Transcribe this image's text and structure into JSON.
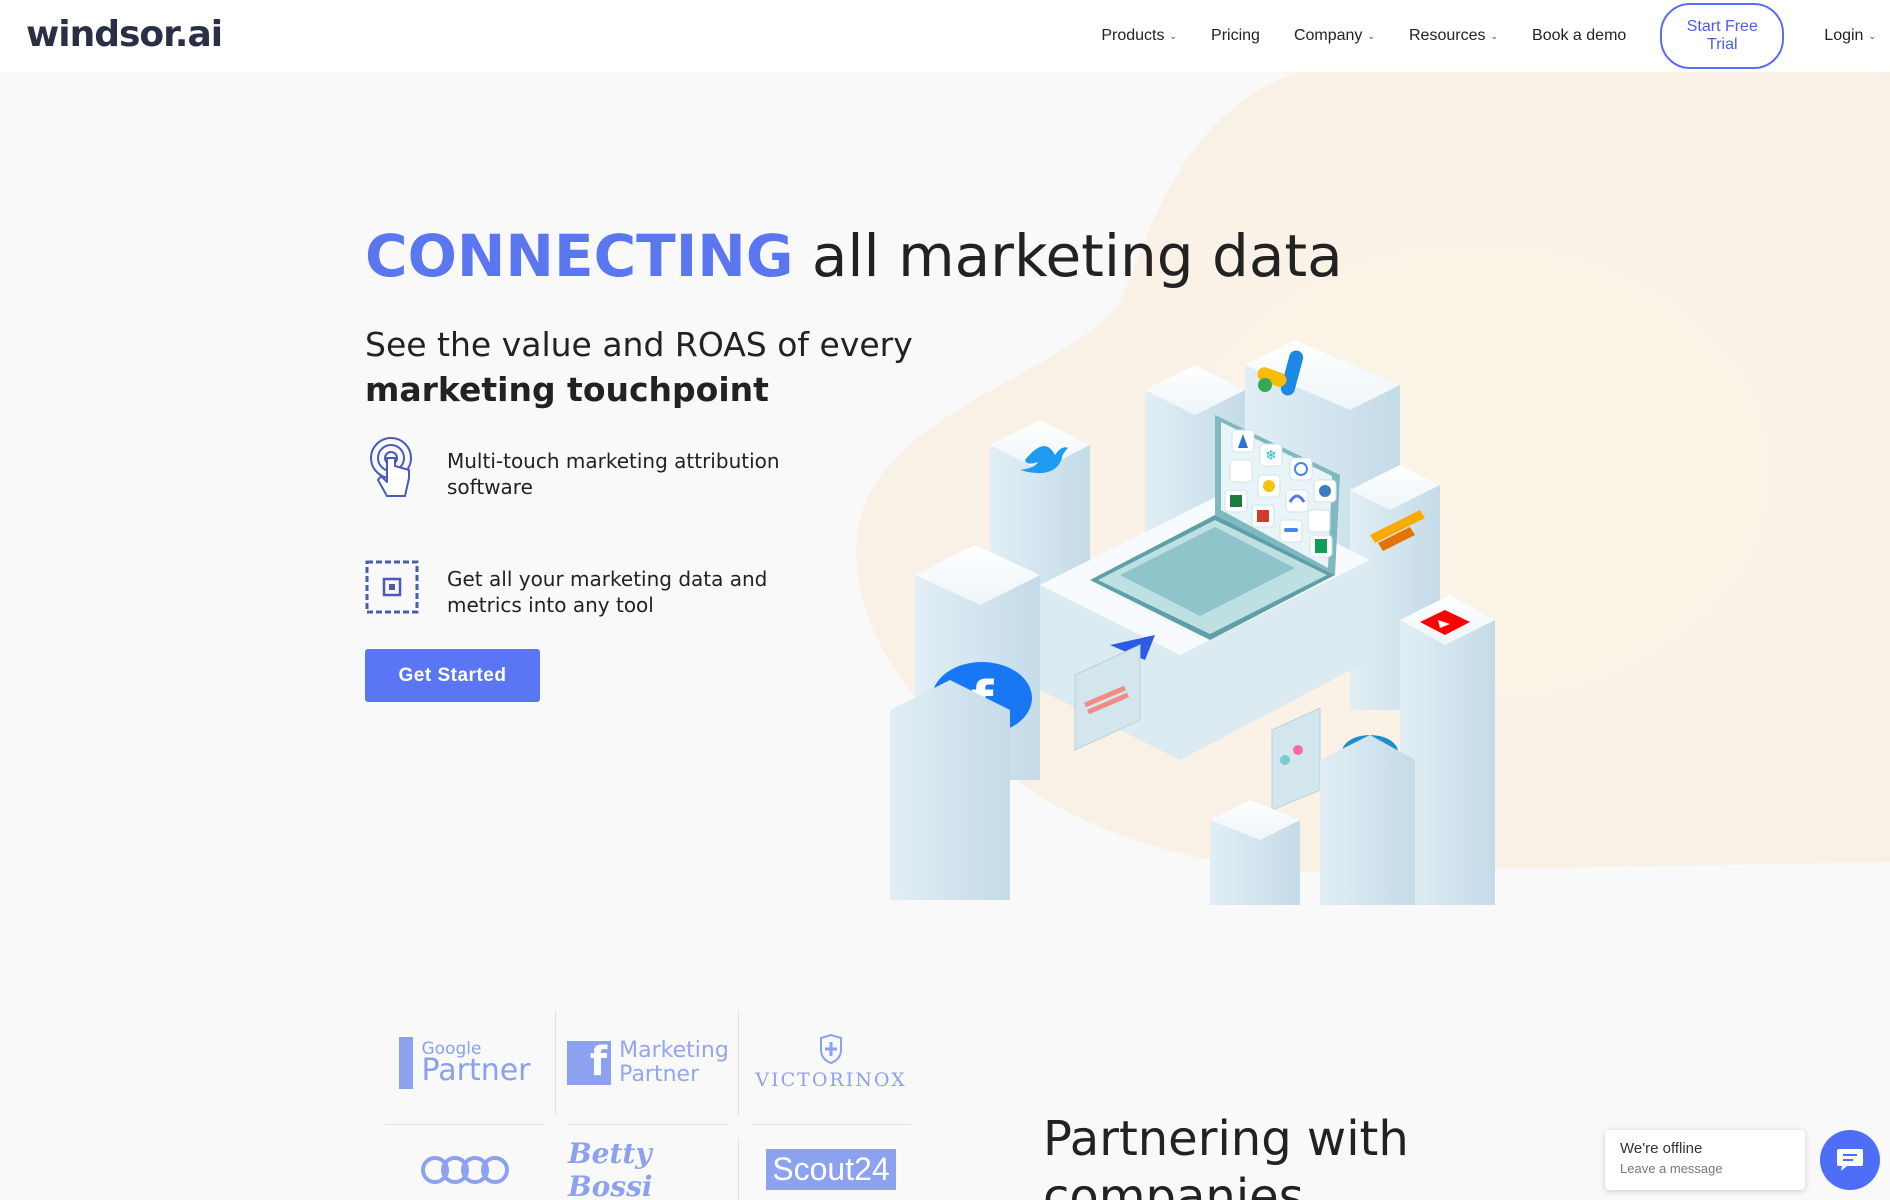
{
  "nav": {
    "logo": "windsor.ai",
    "items": [
      {
        "label": "Products",
        "has_dropdown": true
      },
      {
        "label": "Pricing",
        "has_dropdown": false
      },
      {
        "label": "Company",
        "has_dropdown": true
      },
      {
        "label": "Resources",
        "has_dropdown": true
      },
      {
        "label": "Book a demo",
        "has_dropdown": false
      }
    ],
    "trial_label": "Start Free Trial",
    "login_label": "Login"
  },
  "hero": {
    "headline_accent": "CONNECTING",
    "headline_rest": "all marketing data",
    "subhead_line1": "See the value and ROAS of every",
    "subhead_line2": "marketing touchpoint",
    "features": [
      {
        "icon": "touch-icon",
        "text": "Multi-touch marketing attribution software"
      },
      {
        "icon": "frame-icon",
        "text": "Get all your marketing data and metrics into any tool"
      }
    ],
    "cta_label": "Get Started"
  },
  "partners": {
    "logos": [
      {
        "name": "Google Partner",
        "line1": "Google",
        "line2": "Partner"
      },
      {
        "name": "Facebook Marketing Partner",
        "line1": "Marketing",
        "line2": "Partner",
        "glyph": "f"
      },
      {
        "name": "Victorinox",
        "text": "VICTORINOX"
      },
      {
        "name": "Audi"
      },
      {
        "name": "Betty Bossi",
        "text": "Betty Bossi"
      },
      {
        "name": "Scout24",
        "text": "Scout24"
      }
    ],
    "heading_line1": "Partnering with",
    "heading_line2": "companies"
  },
  "chat": {
    "status": "We're offline",
    "prompt": "Leave a message"
  },
  "colors": {
    "accent": "#5a76f0",
    "button": "#5a76f5",
    "logo": "#2a2f45",
    "chat": "#4f6ef7"
  }
}
